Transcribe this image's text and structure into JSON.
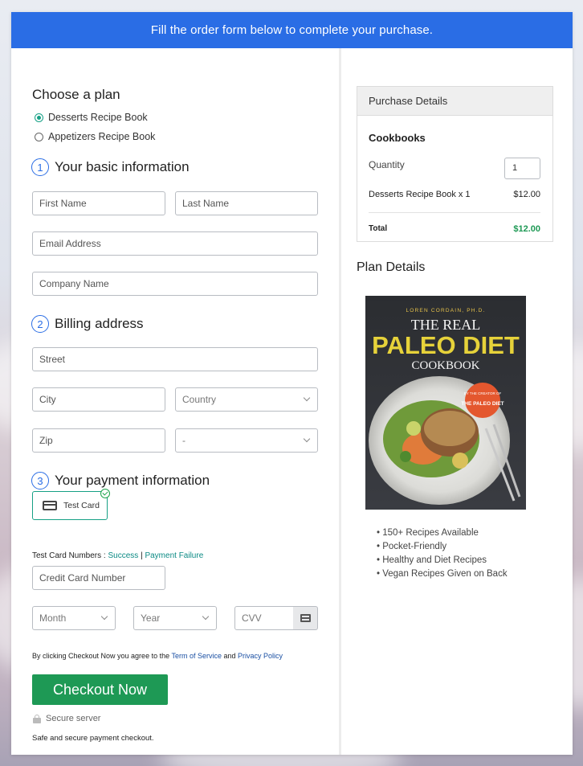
{
  "banner": "Fill the order form below to complete your purchase.",
  "plan": {
    "title": "Choose a plan",
    "options": [
      {
        "label": "Desserts Recipe Book",
        "selected": true
      },
      {
        "label": "Appetizers Recipe Book",
        "selected": false
      }
    ]
  },
  "basic": {
    "number": "1",
    "title": "Your basic information",
    "first_name": "First Name",
    "last_name": "Last Name",
    "email": "Email Address",
    "company": "Company Name"
  },
  "billing": {
    "number": "2",
    "title": "Billing address",
    "street": "Street",
    "city": "City",
    "country": "Country",
    "zip": "Zip",
    "state": "-"
  },
  "payment": {
    "number": "3",
    "title": "Your payment information",
    "test_card": "Test Card",
    "test_numbers_label": "Test Card Numbers :",
    "success": "Success",
    "separator": "|",
    "failure": "Payment Failure",
    "card_number": "Credit Card Number",
    "month": "Month",
    "year": "Year",
    "cvv": "CVV"
  },
  "terms": {
    "prefix": "By clicking Checkout Now you agree to the",
    "tos": "Term of Service",
    "and": "and",
    "privacy": "Privacy Policy"
  },
  "checkout_label": "Checkout Now",
  "secure_server": "Secure server",
  "secure_note": "Safe and secure payment checkout.",
  "purchase": {
    "header": "Purchase Details",
    "category": "Cookbooks",
    "quantity_label": "Quantity",
    "quantity_value": "1",
    "item": "Desserts Recipe Book x 1",
    "item_price": "$12.00",
    "total_label": "Total",
    "total_value": "$12.00"
  },
  "plan_details": {
    "title": "Plan Details",
    "book": {
      "author": "LOREN CORDAIN, PH.D.",
      "line1": "THE REAL",
      "line2": "PALEO DIET",
      "line3": "COOKBOOK",
      "badge_top": "BY THE CREATOR OF",
      "badge_main": "THE PALEO DIET"
    },
    "features": [
      "150+ Recipes Available",
      "Pocket-Friendly",
      "Healthy and Diet Recipes",
      "Vegan Recipes Given on Back"
    ]
  },
  "colors": {
    "banner": "#2a6de5",
    "accent_green": "#1e9955",
    "teal": "#16a085"
  }
}
